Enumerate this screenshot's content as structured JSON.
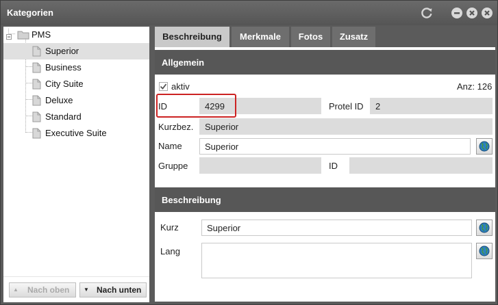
{
  "window": {
    "title": "Kategorien"
  },
  "tree": {
    "root": "PMS",
    "items": [
      "Superior",
      "Business",
      "City Suite",
      "Deluxe",
      "Standard",
      "Executive Suite"
    ],
    "selected": "Superior"
  },
  "left_buttons": {
    "up": "Nach oben",
    "down": "Nach unten"
  },
  "tabs": [
    "Beschreibung",
    "Merkmale",
    "Fotos",
    "Zusatz"
  ],
  "active_tab": "Beschreibung",
  "allgemein": {
    "heading": "Allgemein",
    "aktiv_label": "aktiv",
    "aktiv_checked": true,
    "count_label": "Anz: 126",
    "id_label": "ID",
    "id_value": "4299",
    "protel_label": "Protel ID",
    "protel_value": "2",
    "kurzbez_label": "Kurzbez.",
    "kurzbez_value": "Superior",
    "name_label": "Name",
    "name_value": "Superior",
    "gruppe_label": "Gruppe",
    "gruppe_value": "",
    "gruppe_id_label": "ID",
    "gruppe_id_value": ""
  },
  "beschreibung": {
    "heading": "Beschreibung",
    "kurz_label": "Kurz",
    "kurz_value": "Superior",
    "lang_label": "Lang",
    "lang_value": ""
  },
  "colors": {
    "titlebar": "#5b5b5b",
    "highlight": "#cc2222",
    "selected_row": "#e0e0e0"
  },
  "icons": [
    "refresh-icon",
    "minimize-icon",
    "restore-icon",
    "close-icon",
    "folder-icon",
    "document-icon",
    "checkbox-icon",
    "globe-icon"
  ]
}
